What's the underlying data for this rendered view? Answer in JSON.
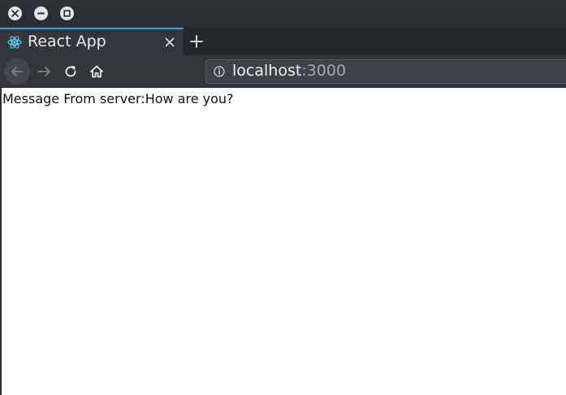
{
  "window": {
    "controls": [
      {
        "name": "close",
        "icon": "close-icon"
      },
      {
        "name": "minimize",
        "icon": "minimize-icon"
      },
      {
        "name": "maximize",
        "icon": "maximize-icon"
      }
    ]
  },
  "tabs": [
    {
      "title": "React App",
      "favicon": "react-logo-icon",
      "active": true
    }
  ],
  "nav": {
    "back_icon": "arrow-left-icon",
    "forward_icon": "arrow-right-icon",
    "reload_icon": "reload-icon",
    "home_icon": "home-icon"
  },
  "address": {
    "host": "localhost",
    "port": ":3000",
    "info_icon": "info-icon"
  },
  "page": {
    "message": "Message From server:How are you?"
  },
  "colors": {
    "accent": "#3b9ce8",
    "chrome": "#33373c",
    "titlebar": "#2a2d31"
  }
}
